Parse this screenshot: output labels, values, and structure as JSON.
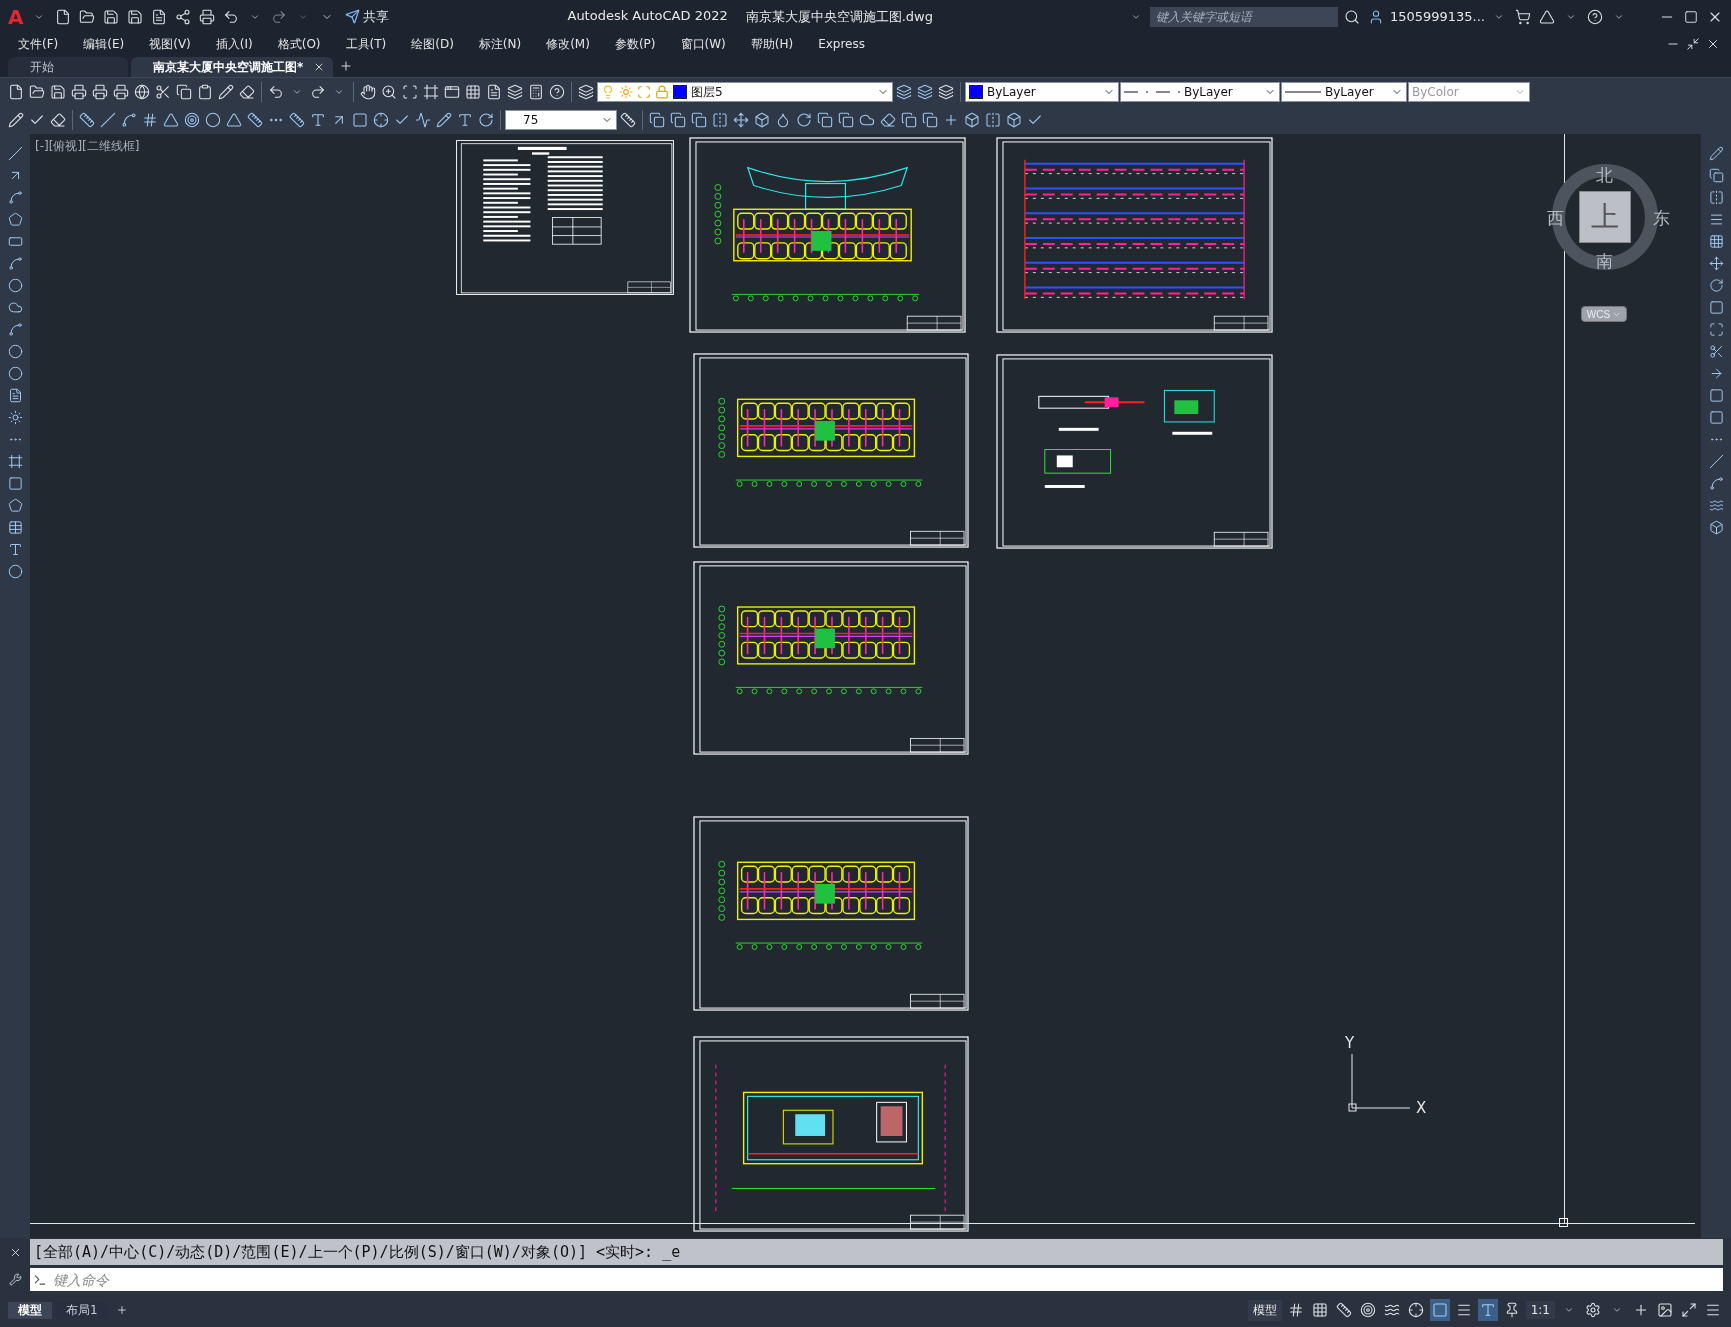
{
  "title_bar": {
    "app_button": "A",
    "share": "共享",
    "app_name": "Autodesk AutoCAD 2022",
    "file_name": "南京某大厦中央空调施工图.dwg",
    "search": {
      "placeholder": "键入关键字或短语"
    },
    "user": "1505999135..."
  },
  "menu": [
    "文件(F)",
    "编辑(E)",
    "视图(V)",
    "插入(I)",
    "格式(O)",
    "工具(T)",
    "绘图(D)",
    "标注(N)",
    "修改(M)",
    "参数(P)",
    "窗口(W)",
    "帮助(H)",
    "Express"
  ],
  "tabs": [
    {
      "label": "开始",
      "selected": false
    },
    {
      "label": "南京某大厦中央空调施工图*",
      "selected": true
    }
  ],
  "properties": {
    "layer": "图层5",
    "color_mode": "ByLayer",
    "linetype": "ByLayer",
    "lineweight": "ByLayer",
    "plot_style": {
      "value": "ByColor",
      "disabled": true
    },
    "dim_scale": "75"
  },
  "viewport_label": "[-][俯视][二维线框]",
  "viewcube": {
    "north": "北",
    "south": "南",
    "east": "东",
    "west": "西",
    "face": "上",
    "coordinate_system": "WCS"
  },
  "ucs": {
    "x": "X",
    "y": "Y"
  },
  "sheets": [
    {
      "kind": "notes"
    },
    {
      "kind": "ground-plan"
    },
    {
      "kind": "riser"
    },
    {
      "kind": "floor-plan"
    },
    {
      "kind": "details"
    },
    {
      "kind": "floor-plan"
    },
    {
      "kind": "floor-plan"
    },
    {
      "kind": "machine-room"
    }
  ],
  "command_history": "[全部(A)/中心(C)/动态(D)/范围(E)/上一个(P)/比例(S)/窗口(W)/对象(O)] <实时>: _e",
  "command_input": {
    "placeholder": "键入命令"
  },
  "layout_tabs": [
    {
      "label": "模型",
      "selected": true
    },
    {
      "label": "布局1",
      "selected": false
    }
  ],
  "status_bar": {
    "space": "模型",
    "scale": "1:1",
    "toggles": [
      {
        "kind": "grid",
        "on": false
      },
      {
        "kind": "snap",
        "on": false
      },
      {
        "kind": "ortho",
        "on": false
      },
      {
        "kind": "polar",
        "on": false
      },
      {
        "kind": "isodraft",
        "on": false
      },
      {
        "kind": "tracking",
        "on": false
      },
      {
        "kind": "osnap",
        "on": true
      },
      {
        "kind": "lineweight",
        "on": false
      },
      {
        "kind": "annotation",
        "on": true
      },
      {
        "kind": "autoscale",
        "on": false
      }
    ]
  }
}
